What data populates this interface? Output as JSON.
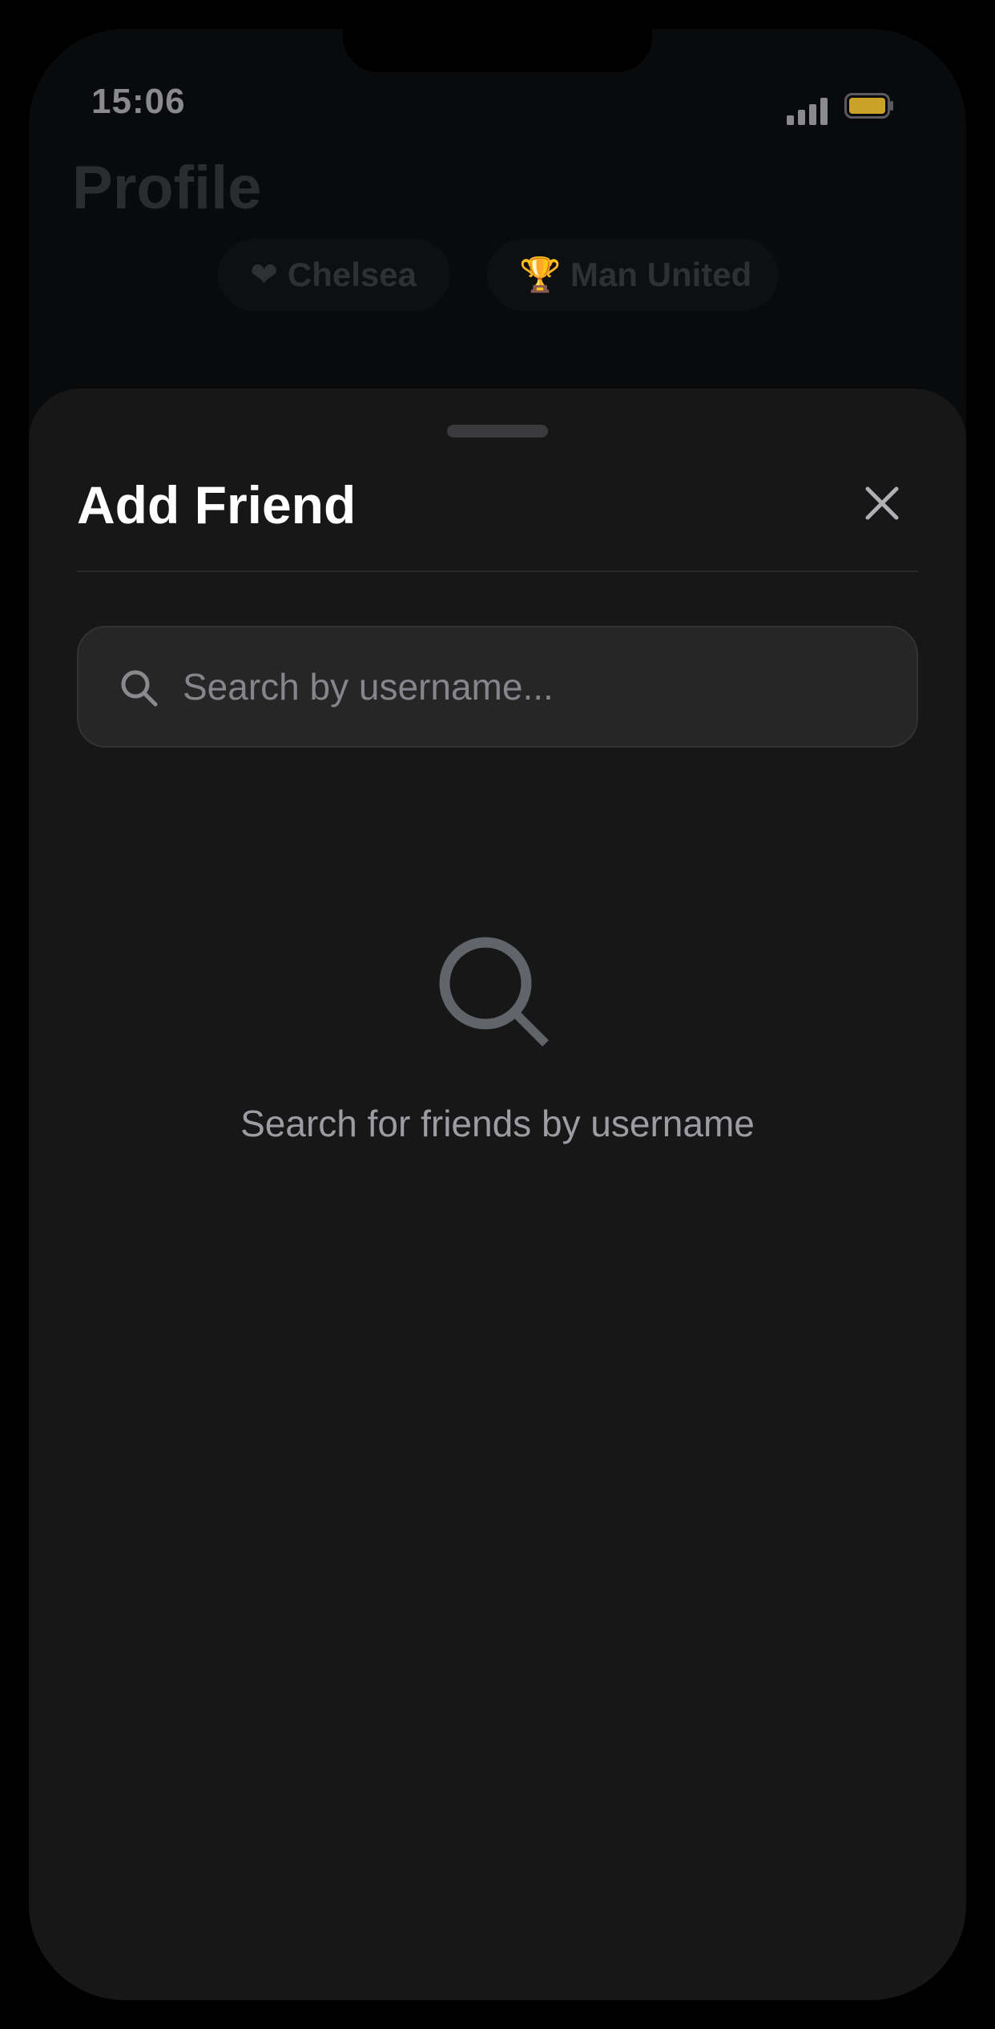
{
  "status_bar": {
    "time": "15:06",
    "signal_icon": "signal-bars-icon",
    "battery_icon": "battery-icon",
    "battery_color": "#c9a227"
  },
  "background_screen": {
    "title": "Profile",
    "chips": [
      {
        "icon": "heart-icon",
        "label": "❤ Chelsea"
      },
      {
        "icon": "trophy-icon",
        "label": "🏆 Man United"
      }
    ]
  },
  "sheet": {
    "title": "Add Friend",
    "close_icon": "close-icon",
    "search": {
      "icon": "search-icon",
      "placeholder": "Search by username...",
      "value": ""
    },
    "empty_state": {
      "icon": "search-icon",
      "message": "Search for friends by username"
    }
  },
  "colors": {
    "sheet_background": "#171717",
    "accent_text": "#ffffff",
    "muted_text": "#9c9da2"
  }
}
